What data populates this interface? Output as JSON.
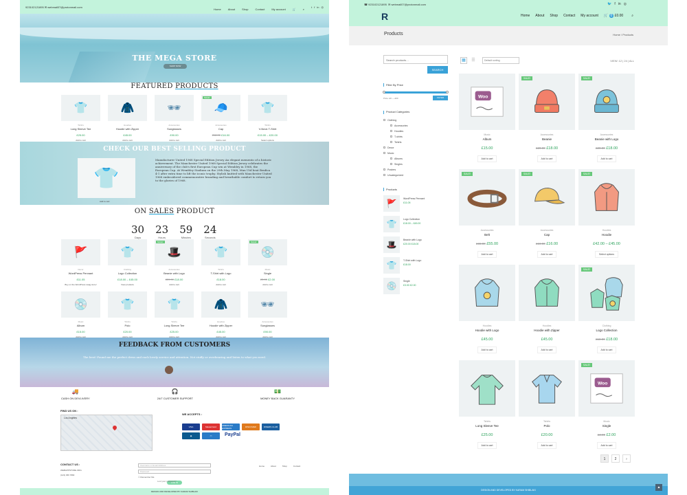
{
  "left": {
    "topbar": {
      "phone": "923102121895",
      "email": "webmail07@protonmail.com"
    },
    "nav": [
      "Home",
      "About",
      "Shop",
      "Contact",
      "My account"
    ],
    "hero": {
      "title": "THE MEGA STORE",
      "button": "SHOP NOW"
    },
    "featured": {
      "title_a": "FEATURED",
      "title_b": "PRODUCTS",
      "items": [
        {
          "cat": "Tshirts",
          "name": "Long Sleeve Tee",
          "price": "£25.00",
          "add": "Add to cart",
          "icon": "👕",
          "sale": ""
        },
        {
          "cat": "Hoodies",
          "name": "Hoodie with Zipper",
          "price": "£45.00",
          "add": "Add to cart",
          "icon": "🧥",
          "sale": ""
        },
        {
          "cat": "Accessories",
          "name": "Sunglasses",
          "price": "£90.00",
          "add": "Add to cart",
          "icon": "🕶",
          "sale": ""
        },
        {
          "cat": "Accessories",
          "name": "Cap",
          "old": "£18.00",
          "price": "£16.00",
          "add": "Add to cart",
          "icon": "🧢",
          "sale": "SALE!"
        },
        {
          "cat": "Tshirts",
          "name": "V-Neck T-Shirt",
          "price": "£15.00 – £20.00",
          "add": "Select options",
          "icon": "👕",
          "sale": ""
        }
      ]
    },
    "best": {
      "title": "CHECK OUR BEST SELLING PRODUCT",
      "text": "Manufacturer United 1968 Special Edition Jersey An elegant memento of a historic achievement. The Manchester United 1968 Special Edition Jersey celebrates the anniversary of the club's first European Cup win at Wembley in 1968, the European Cup. At Wembley Stadium on the 29th May 1968, Man Utd beat Benfica 4-1 after extra time to lift the iconic trophy. Stylish knitted with Manchester United 1968 embroidered commemorative branding and breathable comfort to return you to the glories of 1968.",
      "add": "Add to cart"
    },
    "sales": {
      "title_a": "ON",
      "title_b": "SALES",
      "title_c": "PRODUCT",
      "countdown": [
        {
          "n": "30",
          "l": "Days"
        },
        {
          "n": "23",
          "l": "Hours"
        },
        {
          "n": "59",
          "l": "Minutes"
        },
        {
          "n": "24",
          "l": "Seconds"
        }
      ],
      "row1": [
        {
          "cat": "Decor",
          "name": "WordPress Pennant",
          "price": "£11.05",
          "add": "Buy on the WordPress swag store!",
          "icon": "🚩",
          "sale": ""
        },
        {
          "cat": "Clothing",
          "name": "Logo Collection",
          "price": "£18.00 – £45.00",
          "add": "View products",
          "icon": "👕",
          "sale": ""
        },
        {
          "cat": "Accessories",
          "name": "Beanie with Logo",
          "old": "£20.00",
          "price": "£18.00",
          "add": "Add to cart",
          "icon": "🎩",
          "sale": "SALE!"
        },
        {
          "cat": "Tshirts",
          "name": "T-Shirt with Logo",
          "price": "£18.00",
          "add": "Add to cart",
          "icon": "👕",
          "sale": ""
        },
        {
          "cat": "Music",
          "name": "Single",
          "old": "£3.00",
          "price": "£2.00",
          "add": "Add to cart",
          "icon": "💿",
          "sale": "SALE!"
        }
      ],
      "row2": [
        {
          "cat": "Music",
          "name": "Album",
          "price": "£15.00",
          "add": "Add to cart",
          "icon": "💿",
          "sale": ""
        },
        {
          "cat": "Tshirts",
          "name": "Polo",
          "price": "£20.00",
          "add": "Add to cart",
          "icon": "👕",
          "sale": ""
        },
        {
          "cat": "Tshirts",
          "name": "Long Sleeve Tee",
          "price": "£25.00",
          "add": "Add to cart",
          "icon": "👕",
          "sale": ""
        },
        {
          "cat": "Hoodies",
          "name": "Hoodie with Zipper",
          "price": "£45.00",
          "add": "Add to cart",
          "icon": "🧥",
          "sale": ""
        },
        {
          "cat": "Accessories",
          "name": "Sunglasses",
          "price": "£90.00",
          "add": "Add to cart",
          "icon": "🕶",
          "sale": ""
        }
      ]
    },
    "feedback": {
      "title": "FEEDBACK FROM CUSTOMERS",
      "quote": "The best! Found me the perfect dress and each lovely service and attention. Not stuffy or overbearing and listen to what you need."
    },
    "perks": [
      "CASH ON DEVLIVERY",
      "24/7 CUSTOMER SUPPORT",
      "MONEY BACK GUARANTY"
    ],
    "footer": {
      "find": "FIND US ON :",
      "accepts": "WE ACCEPTS :",
      "map_label": "Los Angeles",
      "contact": "CONTACT US :",
      "address": "WEBAPPSTORE.ORG",
      "phone": "(123) 456 7890",
      "email_ph": "Username or Email Address",
      "pass_ph": "Password",
      "remember": "Remember Me",
      "login": "LOG IN",
      "lost": "Lost your password?",
      "links": [
        "Home",
        "About",
        "Shop",
        "Contact"
      ],
      "bottom": "DESIGN AND DEVELOPED BY KARAM SHIBLAKI"
    },
    "cards": [
      "VISA",
      "MasterCard",
      "AMERICAN EXPRESS",
      "DISCOVER",
      "DINERS CLUB"
    ],
    "paypal": "PayPal"
  },
  "right": {
    "topbar": {
      "phone": "923102121895",
      "email": "webmail07@protonmail.com"
    },
    "nav": [
      "Home",
      "About",
      "Shop",
      "Contact",
      "My account"
    ],
    "cart": {
      "count": "0",
      "total": "£0.00"
    },
    "header": {
      "title": "Products",
      "crumb": "Home / Products"
    },
    "sidebar": {
      "search_ph": "Search products…",
      "search_btn": "SEARCH",
      "filter_title": "Filter By Price",
      "price_range": "Price: £0 — £90",
      "filter_btn": "FILTER",
      "cat_title": "Product Categories",
      "cats": [
        {
          "name": "Clothing",
          "sub": false
        },
        {
          "name": "Accessories",
          "sub": true
        },
        {
          "name": "Hoodies",
          "sub": true
        },
        {
          "name": "T-shirts",
          "sub": true
        },
        {
          "name": "Tshirts",
          "sub": true
        },
        {
          "name": "Decor",
          "sub": false
        },
        {
          "name": "Music",
          "sub": false
        },
        {
          "name": "Albums",
          "sub": true
        },
        {
          "name": "Singles",
          "sub": true
        },
        {
          "name": "Posters",
          "sub": false
        },
        {
          "name": "Uncategorized",
          "sub": false
        }
      ],
      "prod_title": "Products",
      "prods": [
        {
          "name": "WordPress Pennant",
          "price": "£11.05",
          "icon": "🚩"
        },
        {
          "name": "Logo Collection",
          "price": "£18.00 – £45.00",
          "icon": "👕"
        },
        {
          "name": "Beanie with Logo",
          "price": "£20.00 £18.00",
          "icon": "🎩"
        },
        {
          "name": "T-Shirt with Logo",
          "price": "£18.00",
          "icon": "👕"
        },
        {
          "name": "Single",
          "price": "£3.00 £2.00",
          "icon": "💿"
        }
      ]
    },
    "toolbar": {
      "sort": "Default sorting",
      "view": "VIEW: 12 | 24 | ALL"
    },
    "products": [
      {
        "cat": "Music",
        "name": "Album",
        "price": "£15.00",
        "old": "",
        "add": "Add to cart",
        "sale": "",
        "art": "woo"
      },
      {
        "cat": "Accessories",
        "name": "Beanie",
        "price": "£18.00",
        "old": "£20.00",
        "add": "Add to cart",
        "sale": "SALE!",
        "art": "beanie-orange"
      },
      {
        "cat": "Accessories",
        "name": "Beanie with Logo",
        "price": "£18.00",
        "old": "£20.00",
        "add": "Add to cart",
        "sale": "SALE!",
        "art": "beanie-blue"
      },
      {
        "cat": "Accessories",
        "name": "Belt",
        "price": "£55.00",
        "old": "£65.00",
        "add": "Add to cart",
        "sale": "SALE!",
        "art": "belt"
      },
      {
        "cat": "Accessories",
        "name": "Cap",
        "price": "£16.00",
        "old": "£18.00",
        "add": "Add to cart",
        "sale": "SALE!",
        "art": "cap"
      },
      {
        "cat": "Hoodies",
        "name": "Hoodie",
        "price": "£42.00 – £45.00",
        "old": "",
        "add": "Select options",
        "sale": "SALE!",
        "art": "hoodie-red"
      },
      {
        "cat": "Hoodies",
        "name": "Hoodie with Logo",
        "price": "£45.00",
        "old": "",
        "add": "Add to cart",
        "sale": "",
        "art": "hoodie-blue"
      },
      {
        "cat": "Hoodies",
        "name": "Hoodie with Zipper",
        "price": "£45.00",
        "old": "",
        "add": "Add to cart",
        "sale": "",
        "art": "hoodie-green"
      },
      {
        "cat": "Clothing",
        "name": "Logo Collection",
        "price": "£18.00",
        "old": "£18.00",
        "add": "Add to cart",
        "sale": "SALE!",
        "art": "collection"
      },
      {
        "cat": "Tshirts",
        "name": "Long Sleeve Tee",
        "price": "£25.00",
        "old": "",
        "add": "Add to cart",
        "sale": "",
        "art": "longsleeve"
      },
      {
        "cat": "Tshirts",
        "name": "Polo",
        "price": "£20.00",
        "old": "",
        "add": "Add to cart",
        "sale": "",
        "art": "polo"
      },
      {
        "cat": "Music",
        "name": "Single",
        "price": "£2.00",
        "old": "£3.00",
        "add": "Add to cart",
        "sale": "SALE!",
        "art": "woo"
      }
    ],
    "pager": [
      "1",
      "2",
      "›"
    ],
    "footer": "DESIGN AND DEVELOPED BY KARAM SHIBLAKI"
  },
  "colors": {
    "mint": "#c3f3dc",
    "blue": "#3aa2d8",
    "green": "#2aa15a",
    "sale": "#67c87a"
  }
}
